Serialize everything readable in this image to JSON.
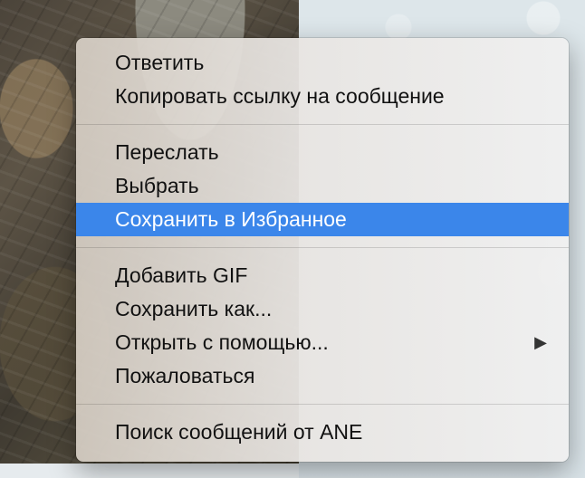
{
  "menu": {
    "groups": [
      [
        {
          "label": "Ответить"
        },
        {
          "label": "Копировать ссылку на сообщение"
        }
      ],
      [
        {
          "label": "Переслать"
        },
        {
          "label": "Выбрать"
        },
        {
          "label": "Сохранить в Избранное",
          "highlighted": true
        }
      ],
      [
        {
          "label": "Добавить GIF"
        },
        {
          "label": "Сохранить как..."
        },
        {
          "label": "Открыть с помощью...",
          "submenu_icon": "▶"
        },
        {
          "label": "Пожаловаться"
        }
      ],
      [
        {
          "label": "Поиск сообщений от ANE"
        }
      ]
    ],
    "highlight_color": "#3b86ea"
  }
}
